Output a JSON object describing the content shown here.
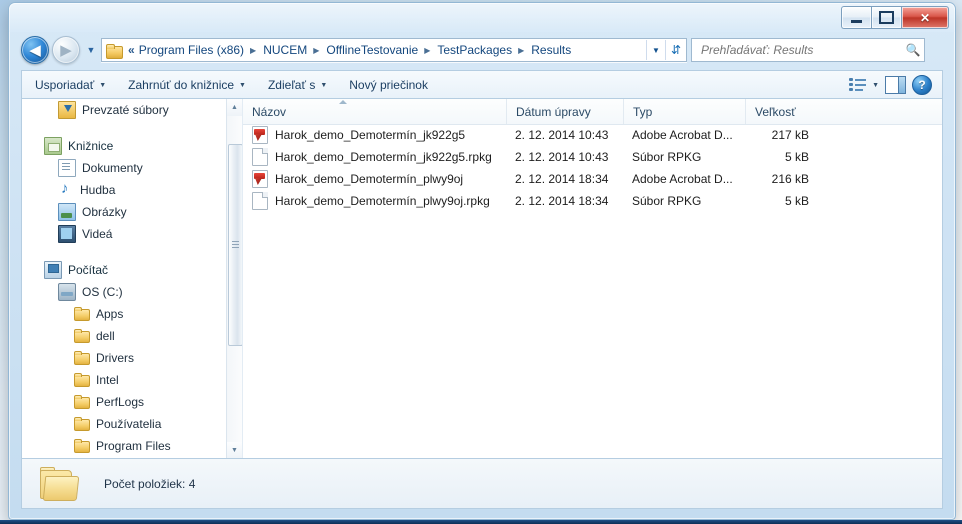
{
  "window": {
    "controls": {
      "minimize_icon": "minimize-icon",
      "maximize_icon": "maximize-icon",
      "close_label": "✕"
    }
  },
  "nav": {
    "back_icon": "◀",
    "forward_icon": "▶",
    "history_caret": "▼",
    "folder_icon": "folder-icon",
    "breadcrumb_overflow": "«",
    "crumbs": [
      "Program Files (x86)",
      "NUCEM",
      "OfflineTestovanie",
      "TestPackages",
      "Results"
    ],
    "separator": "▶",
    "address_dropdown_caret": "▼",
    "refresh_icon": "⇵"
  },
  "search": {
    "placeholder": "Prehľadávať: Results",
    "value": "",
    "icon": "search-icon"
  },
  "toolbar": {
    "items": [
      {
        "label": "Usporiadať",
        "has_caret": true
      },
      {
        "label": "Zahrnúť do knižnice",
        "has_caret": true
      },
      {
        "label": "Zdieľať s",
        "has_caret": true
      },
      {
        "label": "Nový priečinok",
        "has_caret": false
      }
    ],
    "view_caret": "▼",
    "help_label": "?"
  },
  "sidebar": {
    "items": [
      {
        "label": "Prevzaté súbory",
        "icon": "downloads-icon",
        "indent": 1
      },
      {
        "label": "Knižnice",
        "icon": "libraries-icon",
        "indent": 0
      },
      {
        "label": "Dokumenty",
        "icon": "documents-icon",
        "indent": 1
      },
      {
        "label": "Hudba",
        "icon": "music-icon",
        "indent": 1
      },
      {
        "label": "Obrázky",
        "icon": "pictures-icon",
        "indent": 1
      },
      {
        "label": "Videá",
        "icon": "videos-icon",
        "indent": 1
      },
      {
        "label": "Počítač",
        "icon": "computer-icon",
        "indent": 0
      },
      {
        "label": "OS (C:)",
        "icon": "harddisk-icon",
        "indent": 1
      },
      {
        "label": "Apps",
        "icon": "folder-icon",
        "indent": 2
      },
      {
        "label": "dell",
        "icon": "folder-icon",
        "indent": 2
      },
      {
        "label": "Drivers",
        "icon": "folder-icon",
        "indent": 2
      },
      {
        "label": "Intel",
        "icon": "folder-icon",
        "indent": 2
      },
      {
        "label": "PerfLogs",
        "icon": "folder-icon",
        "indent": 2
      },
      {
        "label": "Používatelia",
        "icon": "folder-icon",
        "indent": 2
      },
      {
        "label": "Program Files",
        "icon": "folder-icon",
        "indent": 2
      }
    ],
    "scroll_up": "▲",
    "scroll_down": "▼"
  },
  "filelist": {
    "columns": [
      "Názov",
      "Dátum úpravy",
      "Typ",
      "Veľkosť"
    ],
    "rows": [
      {
        "name": "Harok_demo_Demotermín_jk922g5",
        "date": "2. 12. 2014 10:43",
        "type": "Adobe Acrobat D...",
        "size": "217 kB",
        "icon": "pdf-file-icon"
      },
      {
        "name": "Harok_demo_Demotermín_jk922g5.rpkg",
        "date": "2. 12. 2014 10:43",
        "type": "Súbor RPKG",
        "size": "5 kB",
        "icon": "generic-file-icon"
      },
      {
        "name": "Harok_demo_Demotermín_plwy9oj",
        "date": "2. 12. 2014 18:34",
        "type": "Adobe Acrobat D...",
        "size": "216 kB",
        "icon": "pdf-file-icon"
      },
      {
        "name": "Harok_demo_Demotermín_plwy9oj.rpkg",
        "date": "2. 12. 2014 18:34",
        "type": "Súbor RPKG",
        "size": "5 kB",
        "icon": "generic-file-icon"
      }
    ]
  },
  "statusbar": {
    "text": "Počet položiek: 4"
  },
  "colors": {
    "accent": "#2f86d6",
    "close_button": "#bd3427",
    "pdf_red": "#b8231a",
    "folder_yellow": "#f3c85f"
  }
}
